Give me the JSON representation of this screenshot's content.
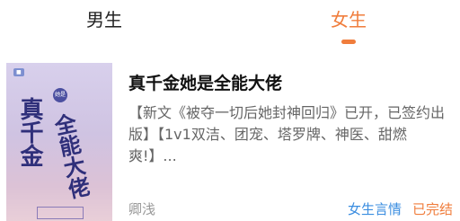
{
  "tabs": {
    "male": "男生",
    "female": "女生",
    "active": "female"
  },
  "colors": {
    "accent": "#f07d3c",
    "category": "#3a8de0"
  },
  "book": {
    "title": "真千金她是全能大佬",
    "description": "【新文《被夺一切后她封神回归》已开，已签约出版】【1v1双洁、团宠、塔罗牌、神医、甜燃爽!】...",
    "author": "卿浅",
    "category": "女生言情",
    "status": "已完结",
    "cover": {
      "title_line1": "真千金",
      "title_line2": "全能大佬",
      "badge": "她是"
    }
  }
}
